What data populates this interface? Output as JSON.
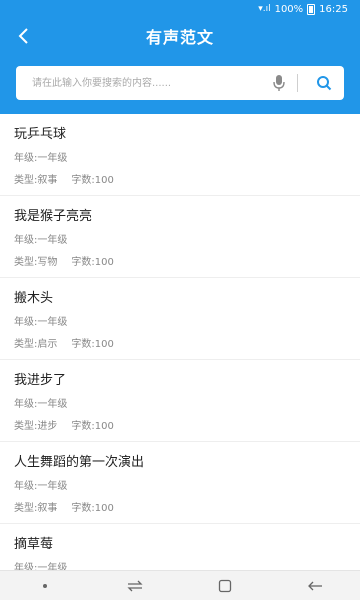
{
  "status": {
    "battery": "100%",
    "time": "16:25"
  },
  "header": {
    "title": "有声范文"
  },
  "search": {
    "placeholder": "请在此输入你要搜索的内容......"
  },
  "items": [
    {
      "title": "玩乒乓球",
      "grade": "年级:一年级",
      "type": "类型:叙事",
      "count": "字数:100"
    },
    {
      "title": "我是猴子亮亮",
      "grade": "年级:一年级",
      "type": "类型:写物",
      "count": "字数:100"
    },
    {
      "title": "搬木头",
      "grade": "年级:一年级",
      "type": "类型:启示",
      "count": "字数:100"
    },
    {
      "title": "我进步了",
      "grade": "年级:一年级",
      "type": "类型:进步",
      "count": "字数:100"
    },
    {
      "title": "人生舞蹈的第一次演出",
      "grade": "年级:一年级",
      "type": "类型:叙事",
      "count": "字数:100"
    },
    {
      "title": "摘草莓",
      "grade": "年级:一年级",
      "type": "",
      "count": ""
    }
  ],
  "colors": {
    "brand": "#2196e8"
  },
  "icons": [
    "signal-icon",
    "battery-icon",
    "back-arrow-icon",
    "microphone-icon",
    "search-icon",
    "nav-dot-icon",
    "nav-recent-icon",
    "nav-home-icon",
    "nav-back-icon"
  ]
}
